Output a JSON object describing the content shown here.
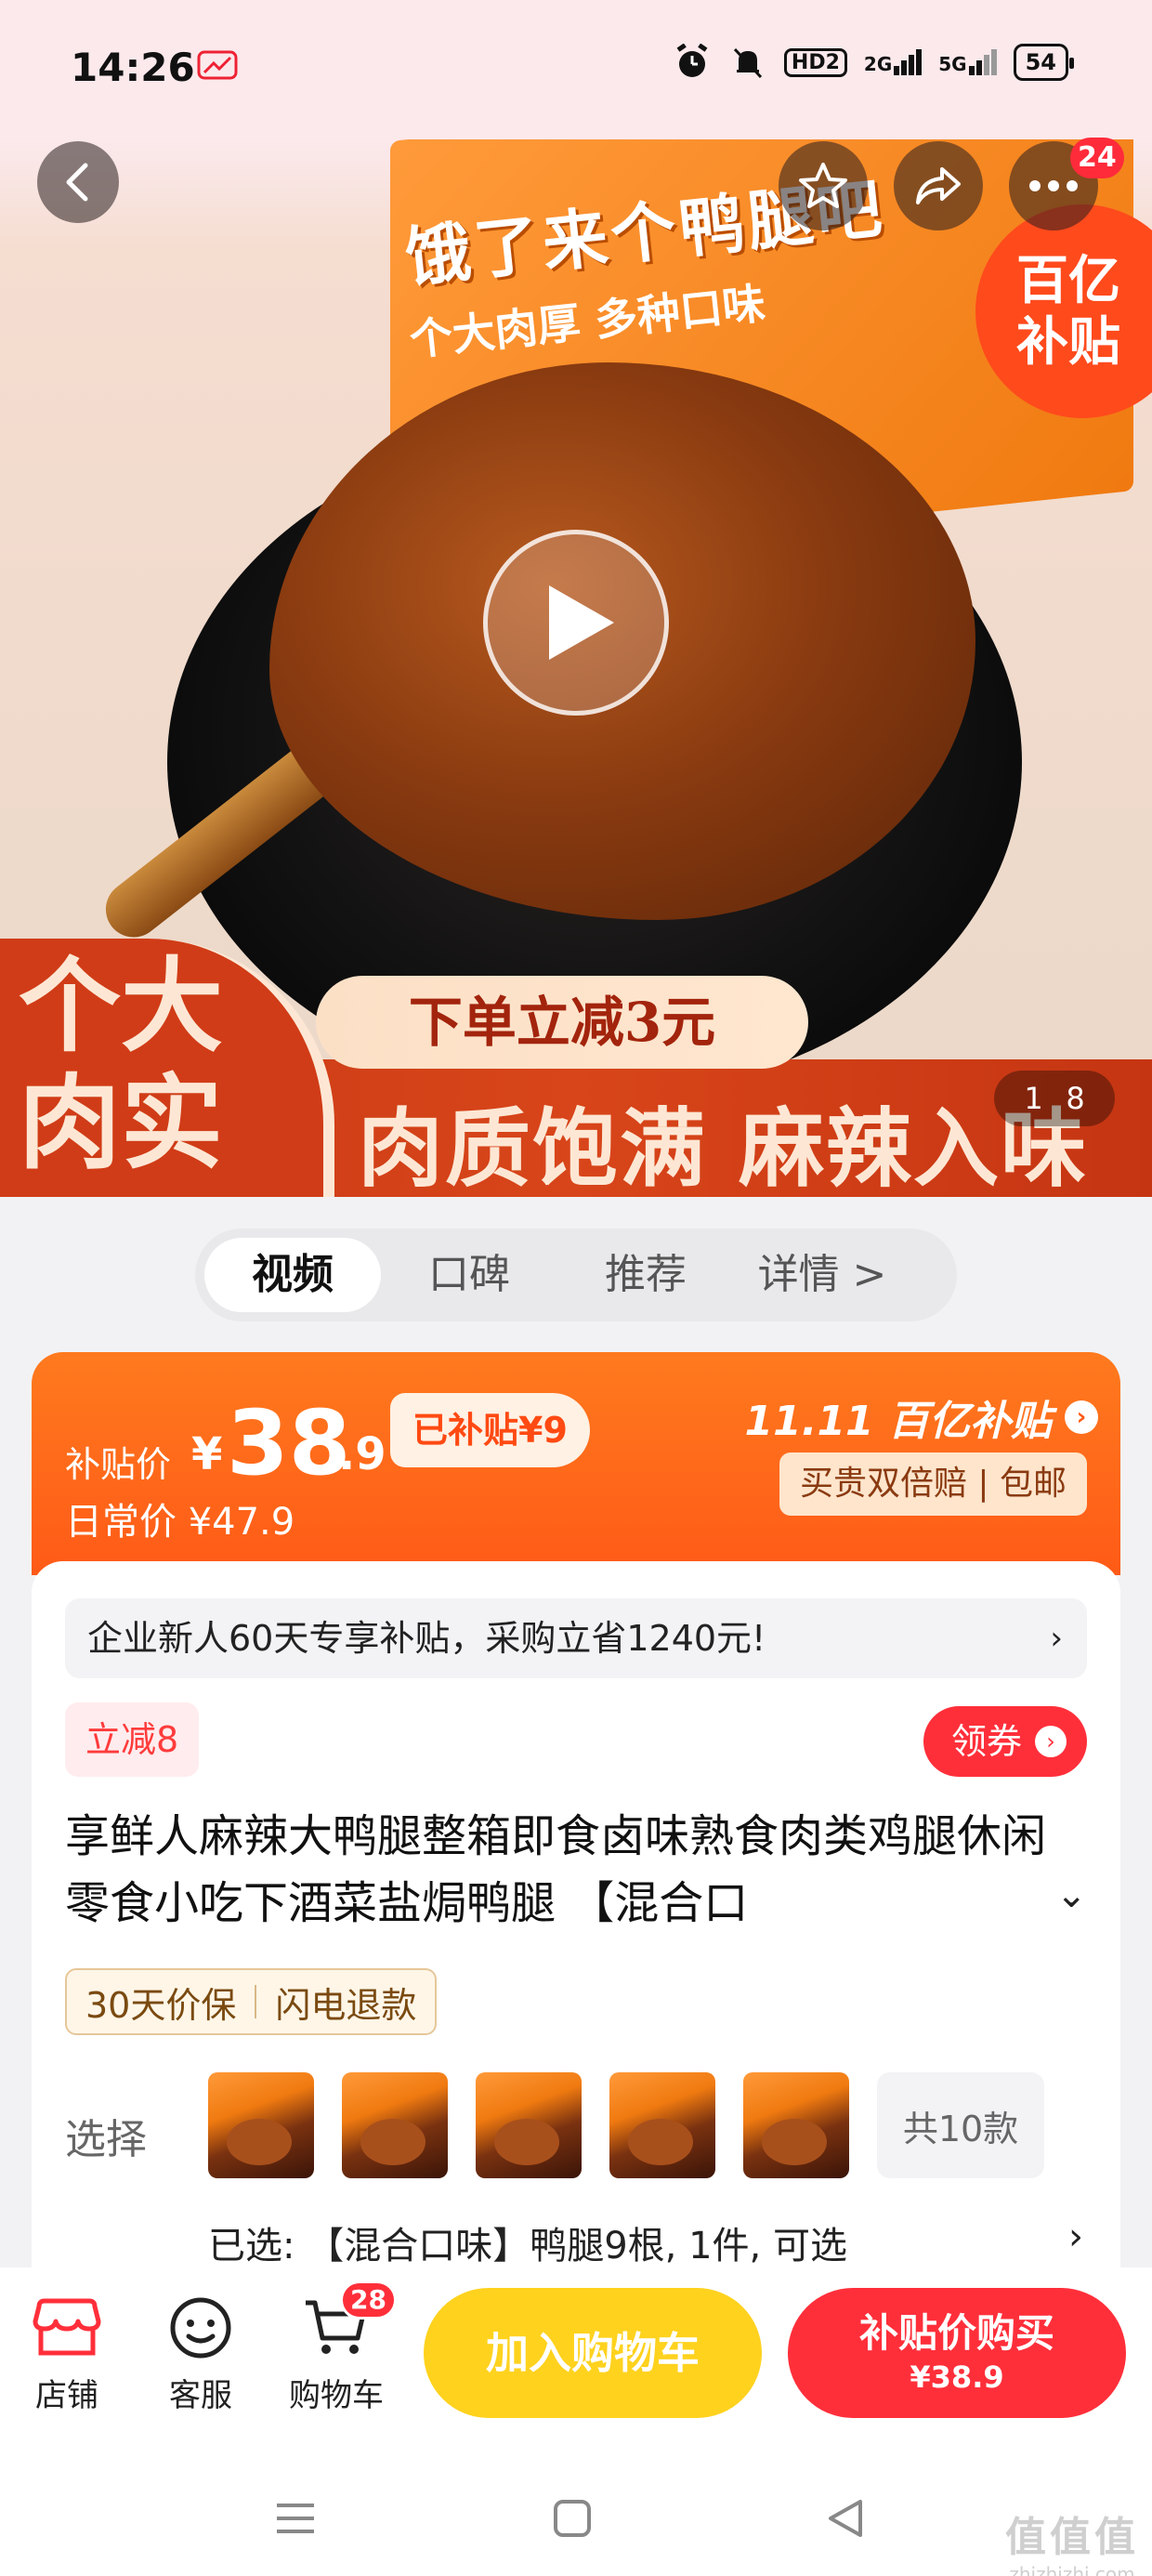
{
  "status_bar": {
    "time": "14:26",
    "hd_label": "HD2",
    "net_2g": "2G",
    "net_5g": "5G",
    "battery": "54"
  },
  "hero": {
    "box_title": "饿了来个鸭腿吧",
    "box_subtitle": "个大肉厚 多种口味",
    "badge_line1": "百亿",
    "badge_line2": "补贴",
    "banner_top": "下单立减3元",
    "banner_left_line1": "个大",
    "banner_left_line2": "肉实",
    "banner_main": "肉质饱满 麻辣入味",
    "page_current": "1",
    "page_total": "8",
    "more_badge": "24"
  },
  "tabs": [
    {
      "label": "视频",
      "active": true
    },
    {
      "label": "口碑",
      "active": false
    },
    {
      "label": "推荐",
      "active": false
    },
    {
      "label": "详情 >",
      "active": false
    }
  ],
  "price": {
    "label": "补贴价",
    "currency": "¥",
    "integer": "38",
    "decimal": ".9",
    "subsidy_tag": "已补贴¥9",
    "daily_label": "日常价 ¥47.9",
    "campaign": "11.11 百亿补贴",
    "guarantee": "买贵双倍赔 | 包邮"
  },
  "content": {
    "promo_text": "企业新人60天专享补贴，采购立省1240元!",
    "promo_chevron": "›",
    "lijian": "立减8",
    "coupon_label": "领券",
    "title": "享鲜人麻辣大鸭腿整箱即食卤味熟食肉类鸡腿休闲零食小吃下酒菜盐焗鸭腿 【混合口",
    "title_chevron": "⌄",
    "service_tag_1": "30天价保",
    "service_tag_2": "闪电退款",
    "select_label": "选择",
    "variants_more": "共10款",
    "selected_text": "已选: 【混合口味】鸭腿9根, 1件, 可选",
    "selected_chevron": "›"
  },
  "action_bar": {
    "shop_label": "店铺",
    "service_label": "客服",
    "cart_label": "购物车",
    "cart_count": "28",
    "add_cart": "加入购物车",
    "buy_line1": "补贴价购买",
    "buy_line2": "¥38.9"
  },
  "watermark": {
    "line1": "值值值",
    "line2": "zhizhizhi.com"
  },
  "colors": {
    "brand_red": "#ff2f3a",
    "price_orange": "#ff5a17",
    "cart_yellow": "#ffd21e"
  }
}
